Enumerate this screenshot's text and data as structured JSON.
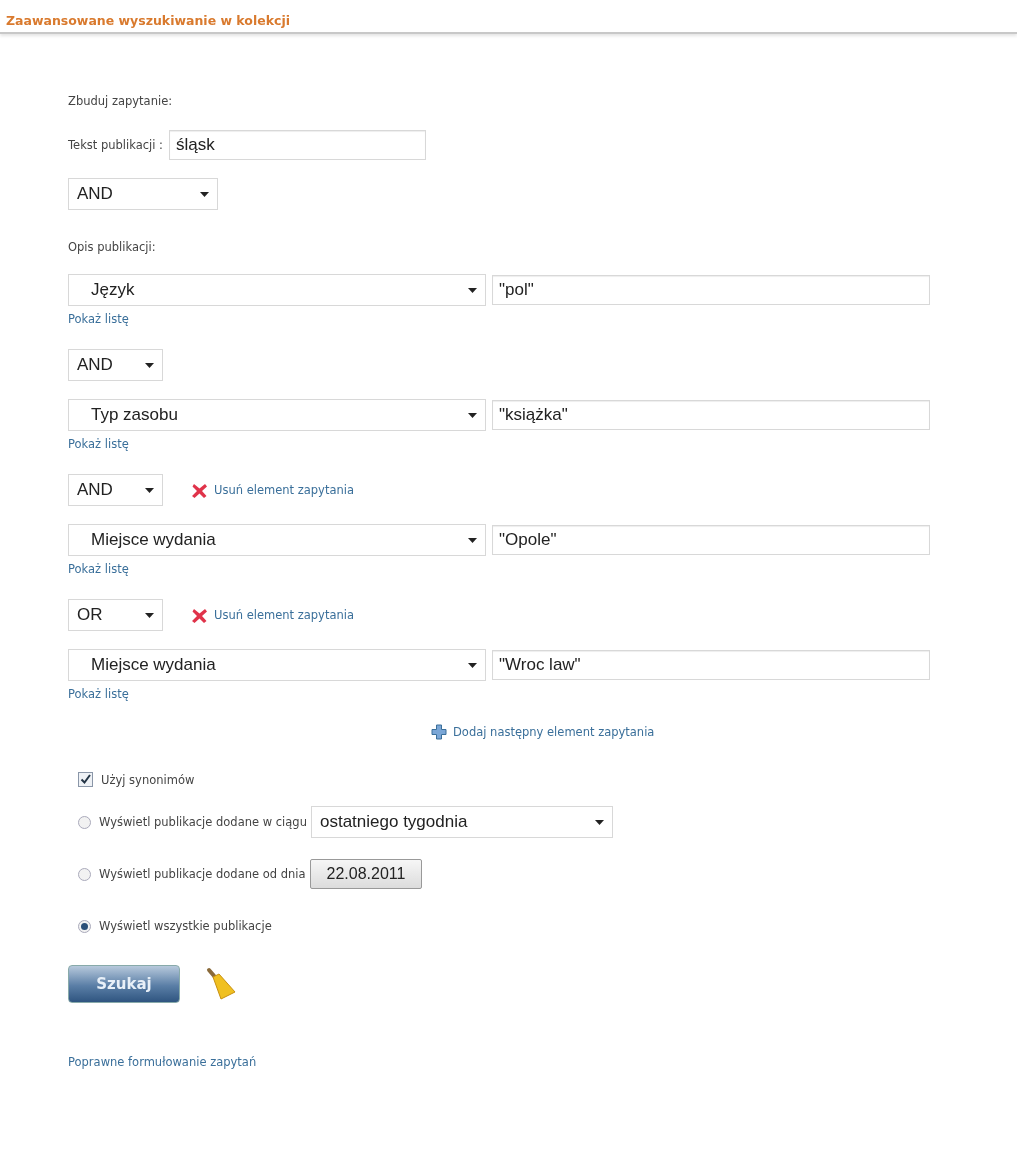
{
  "title": "Zaawansowane wyszukiwanie w kolekcji",
  "query": {
    "heading": "Zbuduj zapytanie:",
    "text_field": {
      "label": "Tekst publikacji :",
      "value": "śląsk"
    },
    "join_operator": "AND",
    "description_label": "Opis publikacji:",
    "conditions": [
      {
        "field": "Język",
        "value": "\"pol\"",
        "show_list": "Pokaż listę"
      },
      {
        "operator": "AND",
        "field": "Typ zasobu",
        "value": "\"książka\"",
        "show_list": "Pokaż listę"
      },
      {
        "operator": "AND",
        "remove_label": "Usuń element zapytania",
        "field": "Miejsce wydania",
        "value": "\"Opole\"",
        "show_list": "Pokaż listę"
      },
      {
        "operator": "OR",
        "remove_label": "Usuń element zapytania",
        "field": "Miejsce wydania",
        "value": "\"Wroc law\"",
        "show_list": "Pokaż listę"
      }
    ],
    "add_label": "Dodaj następny element zapytania"
  },
  "synonyms": {
    "label": "Użyj synonimów",
    "checked": true
  },
  "range_options": [
    {
      "kind": "period",
      "label": "Wyświetl publikacje dodane w ciągu",
      "selected": false,
      "period": "ostatniego tygodnia"
    },
    {
      "kind": "date",
      "label": "Wyświetl publikacje dodane od dnia",
      "selected": false,
      "date": "22.08.2011"
    },
    {
      "kind": "plain",
      "label": "Wyświetl wszystkie publikacje",
      "selected": true
    }
  ],
  "search_button": "Szukaj",
  "help_link": "Poprawne formułowanie zapytań"
}
